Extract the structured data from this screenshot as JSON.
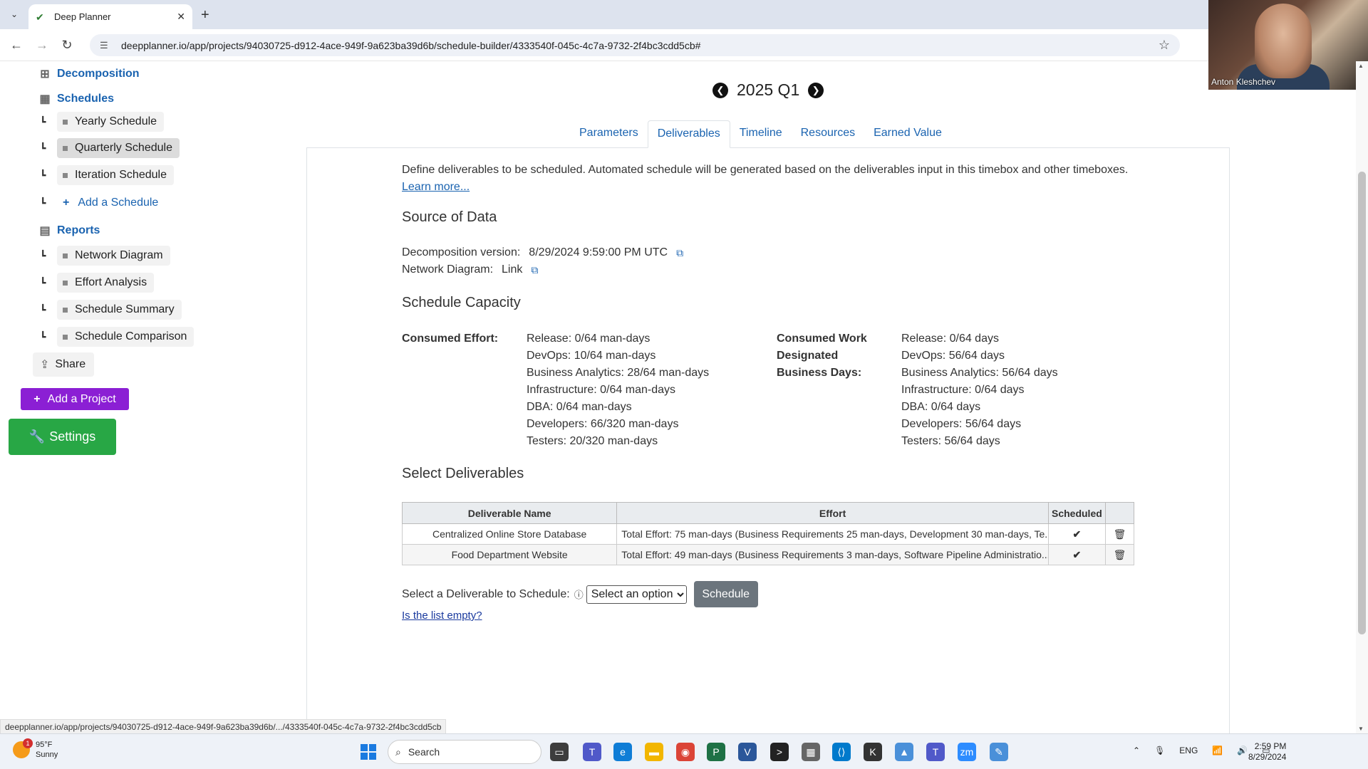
{
  "browser": {
    "tab_title": "Deep Planner",
    "url": "deepplanner.io/app/projects/94030725-d912-4ace-949f-9a623ba39d6b/schedule-builder/4333540f-045c-4c7a-9732-2f4bc3cdd5cb#",
    "status_url": "deepplanner.io/app/projects/94030725-d912-4ace-949f-9a623ba39d6b/.../4333540f-045c-4c7a-9732-2f4bc3cdd5cb"
  },
  "webcam": {
    "name": "Anton Kleshchev"
  },
  "sidebar": {
    "decomposition": "Decomposition",
    "schedules": "Schedules",
    "schedule_items": [
      {
        "label": "Yearly Schedule"
      },
      {
        "label": "Quarterly Schedule"
      },
      {
        "label": "Iteration Schedule"
      }
    ],
    "add_schedule": "Add a Schedule",
    "reports": "Reports",
    "report_items": [
      {
        "label": "Network Diagram"
      },
      {
        "label": "Effort Analysis"
      },
      {
        "label": "Schedule Summary"
      },
      {
        "label": "Schedule Comparison"
      }
    ],
    "share": "Share",
    "add_project": "Add a Project",
    "settings": "Settings"
  },
  "period": {
    "label": "2025 Q1"
  },
  "tabs": [
    {
      "label": "Parameters"
    },
    {
      "label": "Deliverables"
    },
    {
      "label": "Timeline"
    },
    {
      "label": "Resources"
    },
    {
      "label": "Earned Value"
    }
  ],
  "intro": {
    "text": "Define deliverables to be scheduled. Automated schedule will be generated based on the deliverables input in this timebox and other timeboxes.",
    "learn_more": "Learn more..."
  },
  "source": {
    "heading": "Source of Data",
    "decomposition_label": "Decomposition version:",
    "decomposition_value": "8/29/2024 9:59:00 PM UTC",
    "network_label": "Network Diagram:",
    "network_value": "Link"
  },
  "capacity": {
    "heading": "Schedule Capacity",
    "consumed_effort_label": "Consumed Effort:",
    "consumed_effort": [
      "Release: 0/64 man-days",
      "DevOps: 10/64 man-days",
      "Business Analytics: 28/64 man-days",
      "Infrastructure: 0/64 man-days",
      "DBA: 0/64 man-days",
      "Developers: 66/320 man-days",
      "Testers: 20/320 man-days"
    ],
    "consumed_work_label": "Consumed Work Designated Business Days:",
    "consumed_work": [
      "Release: 0/64 days",
      "DevOps: 56/64 days",
      "Business Analytics: 56/64 days",
      "Infrastructure: 0/64 days",
      "DBA: 0/64 days",
      "Developers: 56/64 days",
      "Testers: 56/64 days"
    ]
  },
  "deliverables": {
    "heading": "Select Deliverables",
    "columns": [
      "Deliverable Name",
      "Effort",
      "Scheduled"
    ],
    "rows": [
      {
        "name": "Centralized Online Store Database",
        "effort": "Total Effort: 75 man-days (Business Requirements 25 man-days, Development 30 man-days, Te...",
        "scheduled": true
      },
      {
        "name": "Food Department Website",
        "effort": "Total Effort: 49 man-days (Business Requirements 3 man-days, Software Pipeline Administratio...",
        "scheduled": true
      }
    ],
    "select_label": "Select a Deliverable to Schedule:",
    "select_placeholder": "Select an option",
    "schedule_button": "Schedule",
    "empty_link": "Is the list empty?"
  },
  "taskbar": {
    "temperature": "95°F",
    "weather": "Sunny",
    "weather_badge": "1",
    "search": "Search",
    "lang": "ENG",
    "time": "2:59 PM",
    "date": "8/29/2024"
  },
  "colors": {
    "link": "#1a63b0",
    "add_project": "#8b1fd4",
    "settings": "#28a745",
    "schedule_button": "#6c757d"
  }
}
